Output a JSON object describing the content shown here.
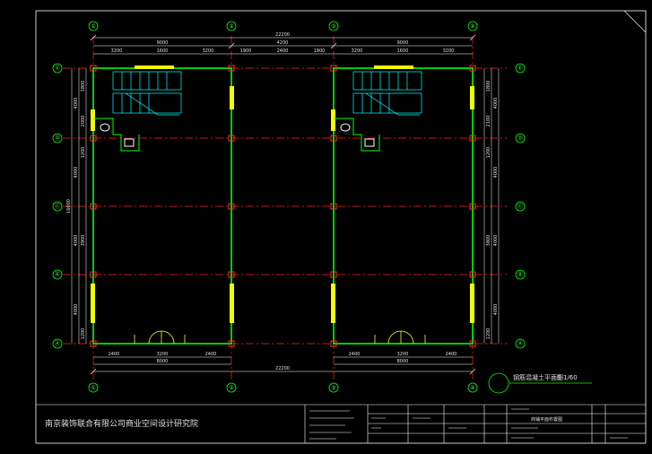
{
  "colors": {
    "background": "#000000",
    "frame": "#ffffff",
    "wall": "#00ff00",
    "column": "#ff3030",
    "axis_line": "#ff2020",
    "window": "#eeff00",
    "stair": "#00ffff",
    "bubble": "#00ff00",
    "dimension": "#ffffff",
    "door": "#ffff00"
  },
  "grid": {
    "vertical_axes": [
      "①",
      "②",
      "③",
      "④"
    ],
    "horizontal_axes": [
      "Ⓔ",
      "Ⓓ",
      "Ⓒ",
      "Ⓑ",
      "Ⓐ"
    ]
  },
  "dimensions": {
    "top_total": "22200",
    "top_bays": [
      "9000",
      "4200",
      "9000"
    ],
    "top_left_segments": [
      "3200",
      "1600",
      "3200"
    ],
    "top_mid_segments": [
      "1900",
      "2400",
      "1900"
    ],
    "top_right_segments": [
      "3200",
      "1600",
      "3200"
    ],
    "bottom_left_segments": [
      "2400",
      "3200",
      "2400"
    ],
    "bottom_right_segments": [
      "2400",
      "3200",
      "2400"
    ],
    "bottom_bays": [
      "8000",
      "8000"
    ],
    "bottom_total": "22200",
    "left_total": "16000",
    "left_bays": [
      "4000",
      "4000",
      "4000",
      "4000"
    ],
    "left_details": [
      "1800",
      "2000",
      "1200",
      "3900",
      "1200"
    ],
    "right_bays": [
      "4000",
      "4000",
      "4000",
      "4000"
    ],
    "right_details": [
      "1800",
      "2100",
      "1200",
      "3800",
      "1200"
    ]
  },
  "drawing_title": {
    "text": "钢筋混凝土平面图",
    "scale": "S-1/60"
  },
  "title_block": {
    "company": "南京装饰联合有限公司商业空间设计研究院",
    "drawing_name": "商铺平面布置图"
  }
}
